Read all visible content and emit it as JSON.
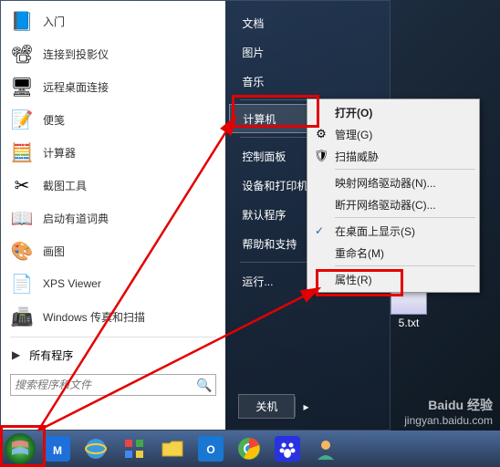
{
  "startMenu": {
    "leftItems": [
      {
        "label": "入门",
        "icon": "📘"
      },
      {
        "label": "连接到投影仪",
        "icon": "📽"
      },
      {
        "label": "远程桌面连接",
        "icon": "🖥"
      },
      {
        "label": "便笺",
        "icon": "📝"
      },
      {
        "label": "计算器",
        "icon": "🧮"
      },
      {
        "label": "截图工具",
        "icon": "✂"
      },
      {
        "label": "启动有道词典",
        "icon": "📖"
      },
      {
        "label": "画图",
        "icon": "🎨"
      },
      {
        "label": "XPS Viewer",
        "icon": "📄"
      },
      {
        "label": "Windows 传真和扫描",
        "icon": "📠"
      }
    ],
    "allPrograms": "所有程序",
    "searchPlaceholder": "搜索程序和文件",
    "rightItems": [
      {
        "label": "文档"
      },
      {
        "label": "图片"
      },
      {
        "label": "音乐"
      },
      {
        "label": "计算机",
        "highlighted": true
      },
      {
        "label": "控制面板"
      },
      {
        "label": "设备和打印机"
      },
      {
        "label": "默认程序"
      },
      {
        "label": "帮助和支持"
      },
      {
        "label": "运行..."
      }
    ],
    "shutdown": "关机"
  },
  "contextMenu": {
    "items": [
      {
        "label": "打开(O)",
        "bold": true
      },
      {
        "label": "管理(G)",
        "icon": "⚙"
      },
      {
        "label": "扫描威胁",
        "icon": "🛡"
      },
      {
        "sep": true
      },
      {
        "label": "映射网络驱动器(N)..."
      },
      {
        "label": "断开网络驱动器(C)..."
      },
      {
        "sep": true
      },
      {
        "label": "在桌面上显示(S)",
        "checked": true
      },
      {
        "label": "重命名(M)"
      },
      {
        "sep": true
      },
      {
        "label": "属性(R)"
      }
    ]
  },
  "desktopFile": {
    "name": "5.txt"
  },
  "watermark": {
    "brand": "Baidu 经验",
    "url": "jingyan.baidu.com"
  },
  "taskbarIcons": [
    "start",
    "maxthon",
    "ie",
    "mse",
    "explorer",
    "outlook",
    "chrome",
    "baidu",
    "user"
  ]
}
